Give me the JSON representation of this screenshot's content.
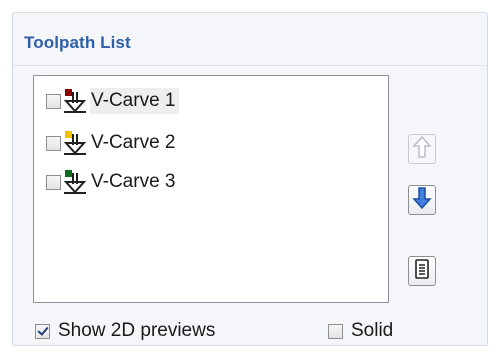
{
  "panel": {
    "title": "Toolpath List"
  },
  "toolpaths": [
    {
      "name": "V-Carve 1",
      "checked": false,
      "color": "#8b0000",
      "selected": true
    },
    {
      "name": "V-Carve 2",
      "checked": false,
      "color": "#f2c200",
      "selected": false
    },
    {
      "name": "V-Carve 3",
      "checked": false,
      "color": "#0f6b1f",
      "selected": false
    }
  ],
  "buttons": {
    "move_up": {
      "icon": "arrow-up-icon",
      "enabled": false
    },
    "move_down": {
      "icon": "arrow-down-icon",
      "enabled": true
    },
    "properties": {
      "icon": "document-icon",
      "enabled": true
    }
  },
  "options": {
    "show_2d_previews": {
      "label": "Show 2D previews",
      "checked": true
    },
    "solid": {
      "label": "Solid",
      "checked": false
    }
  },
  "colors": {
    "title": "#2f5fa8",
    "accent_blue": "#1d5fc9"
  }
}
